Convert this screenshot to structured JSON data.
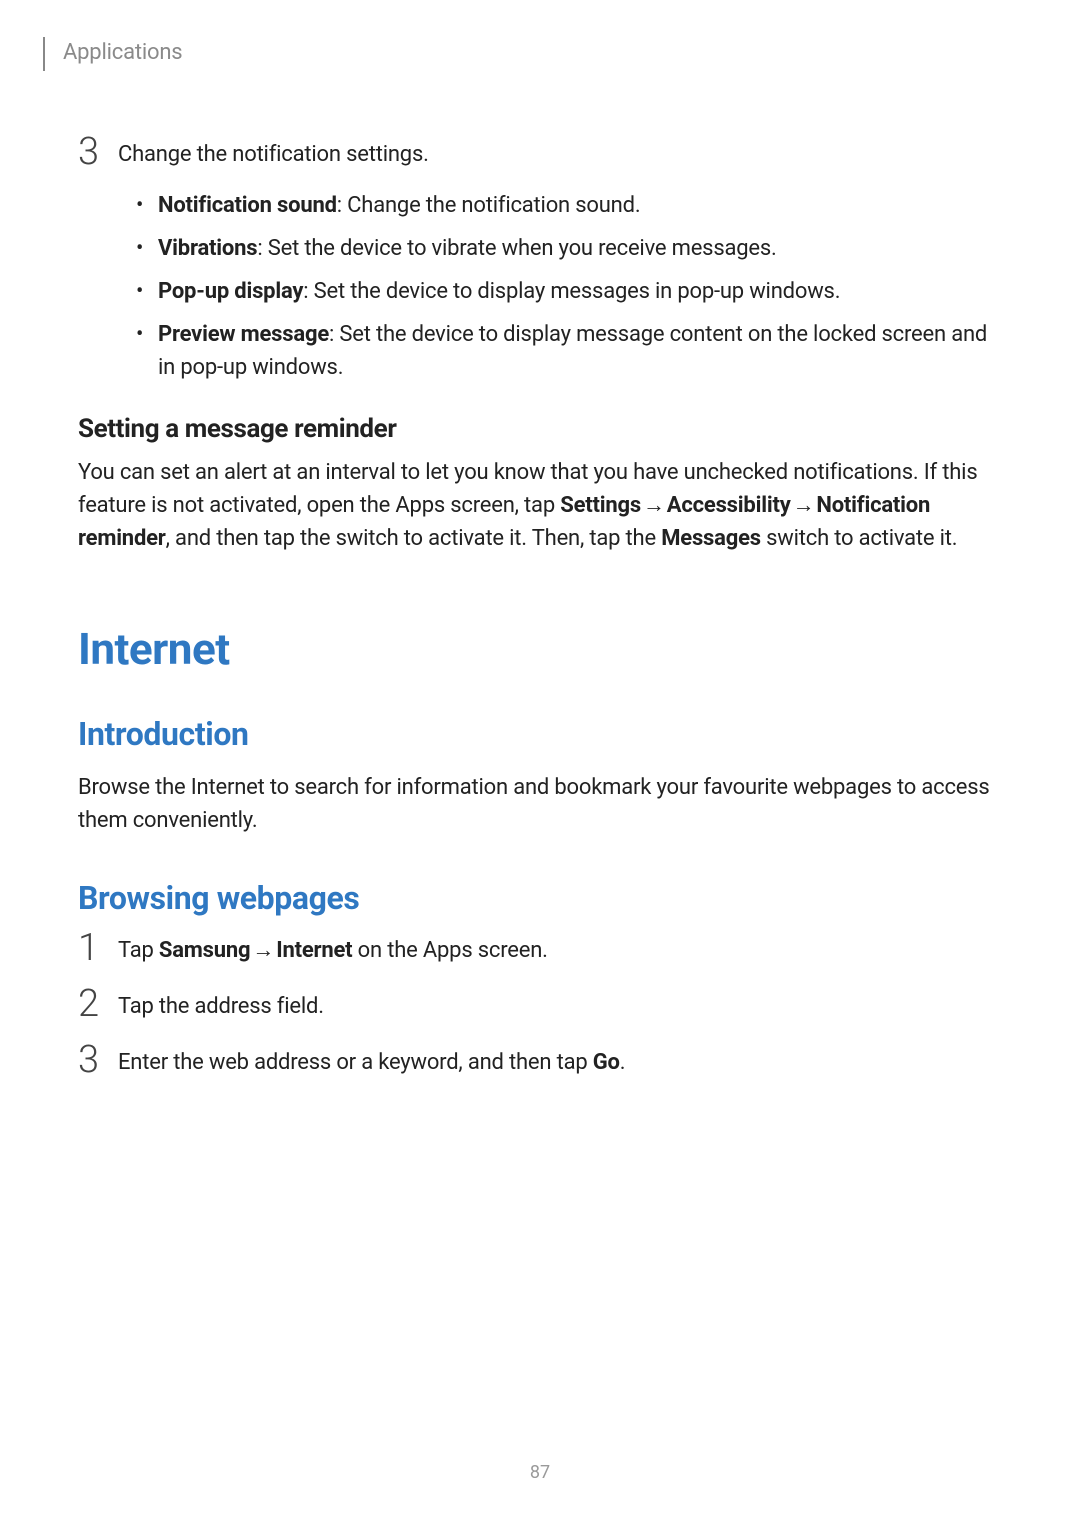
{
  "header": {
    "breadcrumb": "Applications"
  },
  "step3": {
    "num": "3",
    "intro": "Change the notification settings.",
    "bullets": [
      {
        "label": "Notification sound",
        "desc": ": Change the notification sound."
      },
      {
        "label": "Vibrations",
        "desc": ": Set the device to vibrate when you receive messages."
      },
      {
        "label": "Pop-up display",
        "desc": ": Set the device to display messages in pop-up windows."
      },
      {
        "label": "Preview message",
        "desc": ": Set the device to display message content on the locked screen and in pop-up windows."
      }
    ]
  },
  "subhead": "Setting a message reminder",
  "reminder_para": {
    "pre": "You can set an alert at an interval to let you know that you have unchecked notifications. If this feature is not activated, open the Apps screen, tap ",
    "b1": "Settings",
    "arrow": " → ",
    "b2": "Accessibility",
    "pre2": " → ",
    "b3": "Notification reminder",
    "mid": ", and then tap the switch to activate it. Then, tap the ",
    "b4": "Messages",
    "post": " switch to activate it."
  },
  "major": "Internet",
  "intro_h": "Introduction",
  "intro_p": "Browse the Internet to search for information and bookmark your favourite webpages to access them conveniently.",
  "browse_h": "Browsing webpages",
  "browse_steps": [
    {
      "num": "1",
      "parts": {
        "pre": "Tap ",
        "b1": "Samsung",
        "arrow": " → ",
        "b2": "Internet",
        "post": " on the Apps screen."
      }
    },
    {
      "num": "2",
      "text": "Tap the address field."
    },
    {
      "num": "3",
      "parts": {
        "pre": "Enter the web address or a keyword, and then tap ",
        "b1": "Go",
        "post": "."
      }
    }
  ],
  "page_num": "87"
}
